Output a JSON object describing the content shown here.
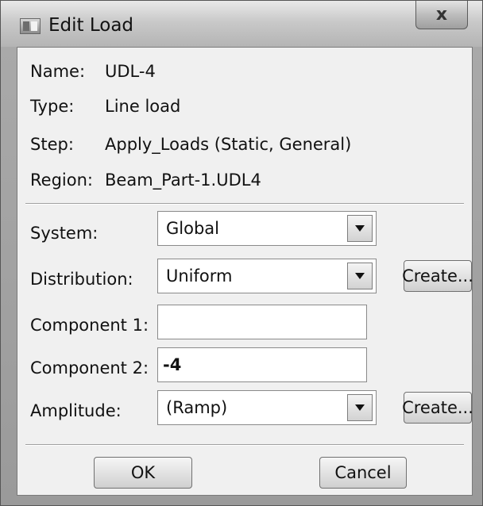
{
  "window": {
    "title": "Edit Load",
    "close_glyph": "x"
  },
  "info": {
    "name_label": "Name:",
    "name_value": "UDL-4",
    "type_label": "Type:",
    "type_value": "Line load",
    "step_label": "Step:",
    "step_value": "Apply_Loads (Static, General)",
    "region_label": "Region:",
    "region_value": "Beam_Part-1.UDL4"
  },
  "form": {
    "system_label": "System:",
    "system_value": "Global",
    "distribution_label": "Distribution:",
    "distribution_value": "Uniform",
    "distribution_create": "Create...",
    "component1_label": "Component 1:",
    "component1_value": "",
    "component2_label": "Component 2:",
    "component2_value": "-4",
    "amplitude_label": "Amplitude:",
    "amplitude_value": "(Ramp)",
    "amplitude_create": "Create..."
  },
  "buttons": {
    "ok": "OK",
    "cancel": "Cancel"
  }
}
